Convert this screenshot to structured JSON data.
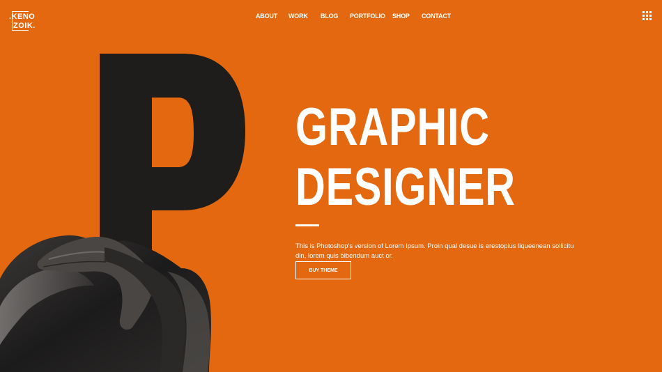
{
  "brand": {
    "logo_line1": ".KENO",
    "logo_line2": "ZOIK."
  },
  "nav": {
    "items": [
      {
        "label": "ABOUT"
      },
      {
        "label": "WORK"
      },
      {
        "label": "BLOG"
      },
      {
        "label": "PORTFOLIO"
      },
      {
        "label": "SHOP"
      },
      {
        "label": "CONTACT"
      }
    ],
    "menu_icon": "grid-menu-icon"
  },
  "hero": {
    "headline_line1": "GRAPHIC",
    "headline_line2": "DESIGNER",
    "description": "This is Photoshop's version  of Lorem Ipsum. Proin qual desue is erestopius liqueenean sollicitu din, lorem quis bibendum auct or.",
    "button_label": "BUY THEME",
    "image_icon": "letter-p-portrait-image"
  },
  "colors": {
    "background": "#e4680f",
    "text": "#ffffff",
    "letter": "#1f1d1c"
  }
}
